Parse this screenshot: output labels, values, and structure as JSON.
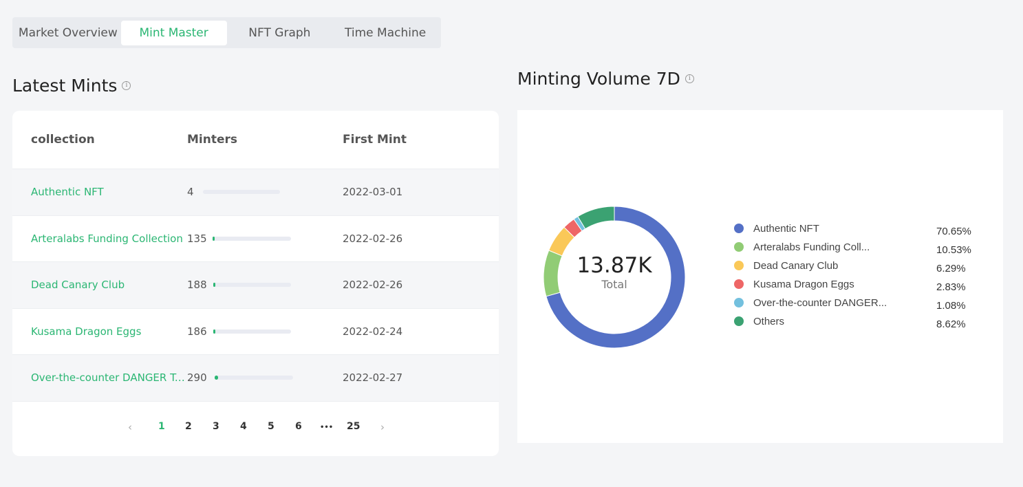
{
  "tabs": [
    {
      "label": "Market Overview",
      "active": false
    },
    {
      "label": "Mint Master",
      "active": true
    },
    {
      "label": "NFT Graph",
      "active": false
    },
    {
      "label": "Time Machine",
      "active": false
    }
  ],
  "latest_mints": {
    "title": "Latest Mints",
    "columns": [
      "collection",
      "Minters",
      "First Mint"
    ],
    "rows": [
      {
        "collection": "Authentic NFT",
        "minters": "4",
        "first_mint": "2022-03-01",
        "bar_fraction": 0.0
      },
      {
        "collection": "Arteralabs Funding Collection",
        "minters": "135",
        "first_mint": "2022-02-26",
        "bar_fraction": 0.02
      },
      {
        "collection": "Dead Canary Club",
        "minters": "188",
        "first_mint": "2022-02-26",
        "bar_fraction": 0.03
      },
      {
        "collection": "Kusama Dragon Eggs",
        "minters": "186",
        "first_mint": "2022-02-24",
        "bar_fraction": 0.03
      },
      {
        "collection": "Over-the-counter DANGER To...",
        "minters": "290",
        "first_mint": "2022-02-27",
        "bar_fraction": 0.04
      }
    ],
    "pagination": {
      "prev": "‹",
      "next": "›",
      "pages": [
        "1",
        "2",
        "3",
        "4",
        "5",
        "6",
        "•••",
        "25"
      ],
      "current": "1"
    }
  },
  "minting_volume": {
    "title": "Minting Volume 7D",
    "total_value": "13.87K",
    "total_label": "Total"
  },
  "chart_data": {
    "type": "pie",
    "title": "Minting Volume 7D",
    "donut": true,
    "center_text": "13.87K",
    "center_label": "Total",
    "legend_position": "right",
    "series": [
      {
        "name": "Authentic NFT",
        "value": 70.65,
        "label": "70.65%",
        "color": "#5470c6"
      },
      {
        "name": "Arteralabs Funding Coll...",
        "value": 10.53,
        "label": "10.53%",
        "color": "#91cc75"
      },
      {
        "name": "Dead Canary Club",
        "value": 6.29,
        "label": "6.29%",
        "color": "#fac858"
      },
      {
        "name": "Kusama Dragon Eggs",
        "value": 2.83,
        "label": "2.83%",
        "color": "#ee6666"
      },
      {
        "name": "Over-the-counter DANGER...",
        "value": 1.08,
        "label": "1.08%",
        "color": "#73c0de"
      },
      {
        "name": "Others",
        "value": 8.62,
        "label": "8.62%",
        "color": "#3ba272"
      }
    ]
  },
  "colors": {
    "accent": "#2bb673"
  }
}
